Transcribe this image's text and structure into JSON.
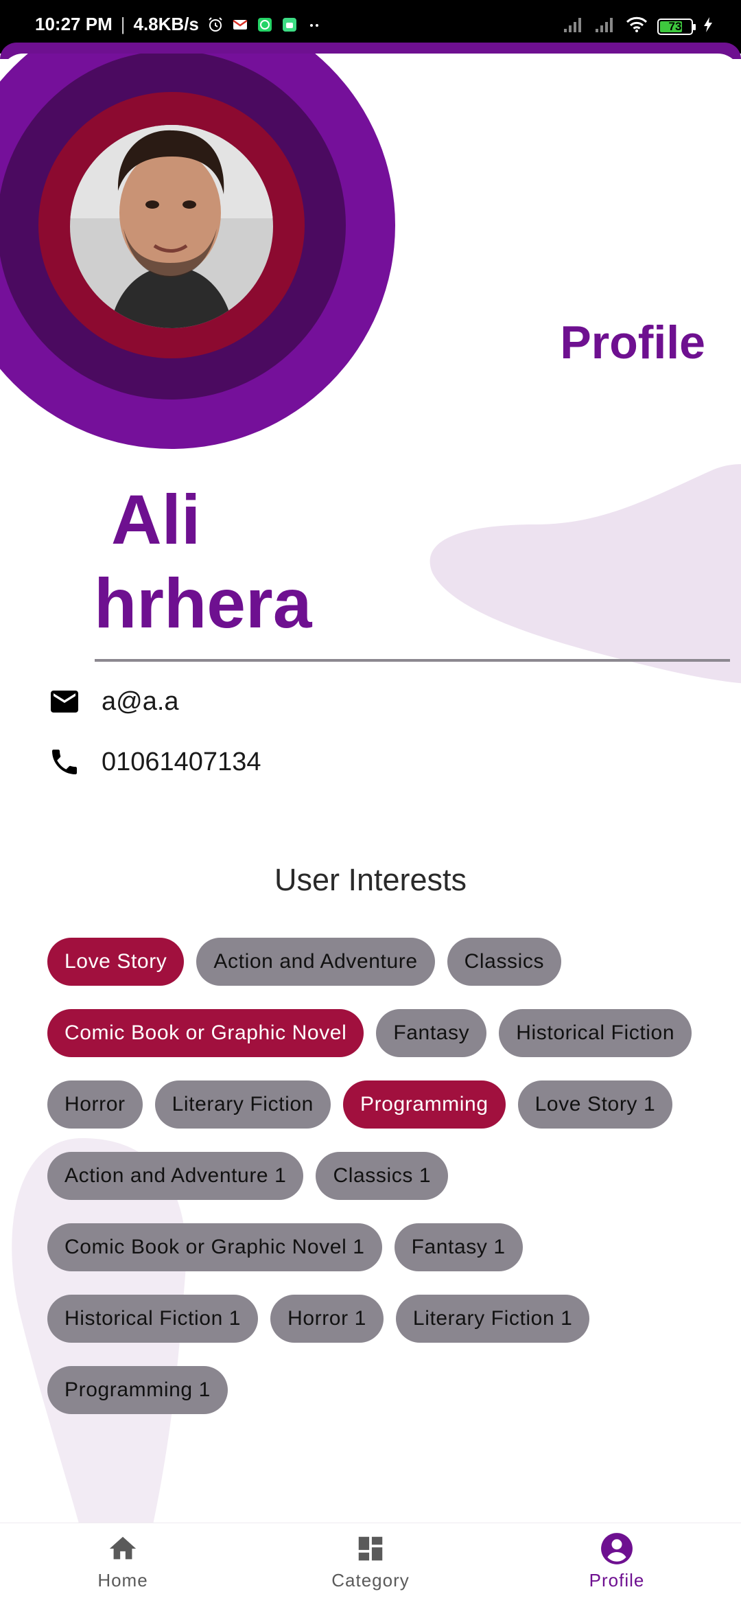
{
  "status_bar": {
    "time": "10:27 PM",
    "speed": "4.8KB/s",
    "battery": "73",
    "battery_level": 0.73,
    "icons": [
      "alarm-icon",
      "gmail-icon",
      "whatsapp-icon",
      "android-icon",
      "more-dots-icon",
      "signal-icon",
      "signal-icon",
      "wifi-icon",
      "battery-icon",
      "charging-icon"
    ]
  },
  "header": {
    "title": "Profile"
  },
  "profile": {
    "first_name": "Ali",
    "last_name": "hrhera",
    "avatar_icon": "user-photo"
  },
  "contact": {
    "email_icon": "mail-icon",
    "email": "a@a.a",
    "phone_icon": "phone-icon",
    "phone": "01061407134"
  },
  "interests": {
    "title": "User Interests",
    "chips": [
      {
        "label": "Love Story",
        "selected": true
      },
      {
        "label": "Action and Adventure",
        "selected": false
      },
      {
        "label": "Classics",
        "selected": false
      },
      {
        "label": "Comic Book or Graphic Novel",
        "selected": true
      },
      {
        "label": "Fantasy",
        "selected": false
      },
      {
        "label": "Historical Fiction",
        "selected": false
      },
      {
        "label": "Horror",
        "selected": false
      },
      {
        "label": "Literary Fiction",
        "selected": false
      },
      {
        "label": "Programming",
        "selected": true
      },
      {
        "label": "Love Story 1",
        "selected": false
      },
      {
        "label": "Action and Adventure 1",
        "selected": false
      },
      {
        "label": "Classics 1",
        "selected": false
      },
      {
        "label": "Comic Book or Graphic Novel 1",
        "selected": false
      },
      {
        "label": "Fantasy 1",
        "selected": false
      },
      {
        "label": "Historical Fiction 1",
        "selected": false
      },
      {
        "label": "Horror 1",
        "selected": false
      },
      {
        "label": "Literary Fiction 1",
        "selected": false
      },
      {
        "label": "Programming 1",
        "selected": false
      }
    ]
  },
  "bottom_nav": {
    "items": [
      {
        "label": "Home",
        "icon": "home-icon",
        "active": false
      },
      {
        "label": "Category",
        "icon": "dashboard-icon",
        "active": false
      },
      {
        "label": "Profile",
        "icon": "account-circle-icon",
        "active": true
      }
    ]
  },
  "colors": {
    "primary": "#6e1090",
    "ring_outer": "#75109a",
    "ring_middle": "#4b0a60",
    "ring_inner": "#8c0a30",
    "chip_selected": "#a1103e",
    "chip_default": "#8a868f",
    "blob": "#ede2f0"
  }
}
